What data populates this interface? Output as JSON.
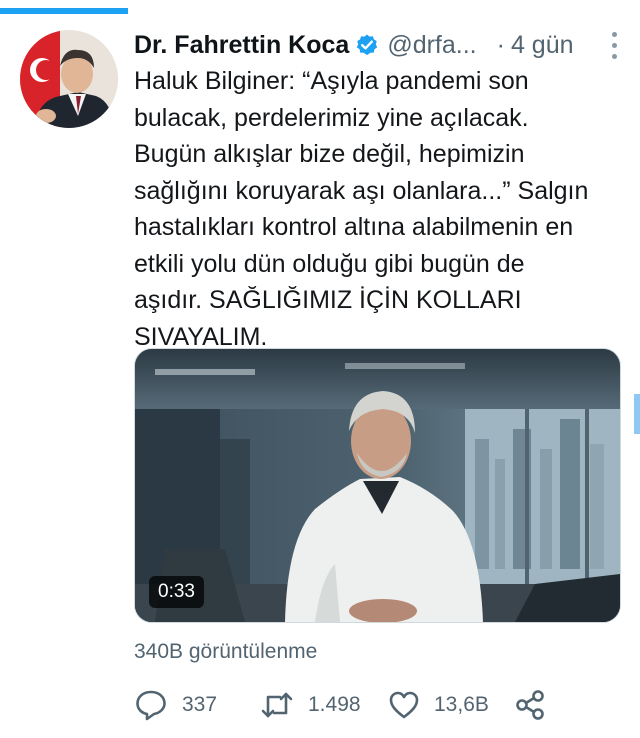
{
  "tweet": {
    "author_name": "Dr. Fahrettin Koca",
    "handle": "@drfa...",
    "separator": "·",
    "time": "4 gün",
    "text": "Haluk Bilginer: “Aşıyla pandemi son\nbulacak, perdelerimiz yine açılacak.\nBugün alkışlar bize değil, hepimizin\nsağlığını koruyarak aşı olanlara...” Salgın\nhastalıkları kontrol altına alabilmenin en\netkili yolu dün olduğu gibi bugün de\naşıdır. SAĞLIĞIMIZ İÇİN KOLLARI\nSIVAYALIM.",
    "video_duration": "0:33",
    "views": "340B görüntülenme",
    "replies": "337",
    "retweets": "1.498",
    "likes": "13,6B"
  },
  "icons": {
    "verified": "verified-badge-icon",
    "more": "more-vertical-icon",
    "reply": "reply-icon",
    "retweet": "retweet-icon",
    "like": "heart-icon",
    "share": "share-icon"
  },
  "colors": {
    "accent": "#1da1f2",
    "secondary_text": "#536471",
    "primary_text": "#0f1419"
  }
}
